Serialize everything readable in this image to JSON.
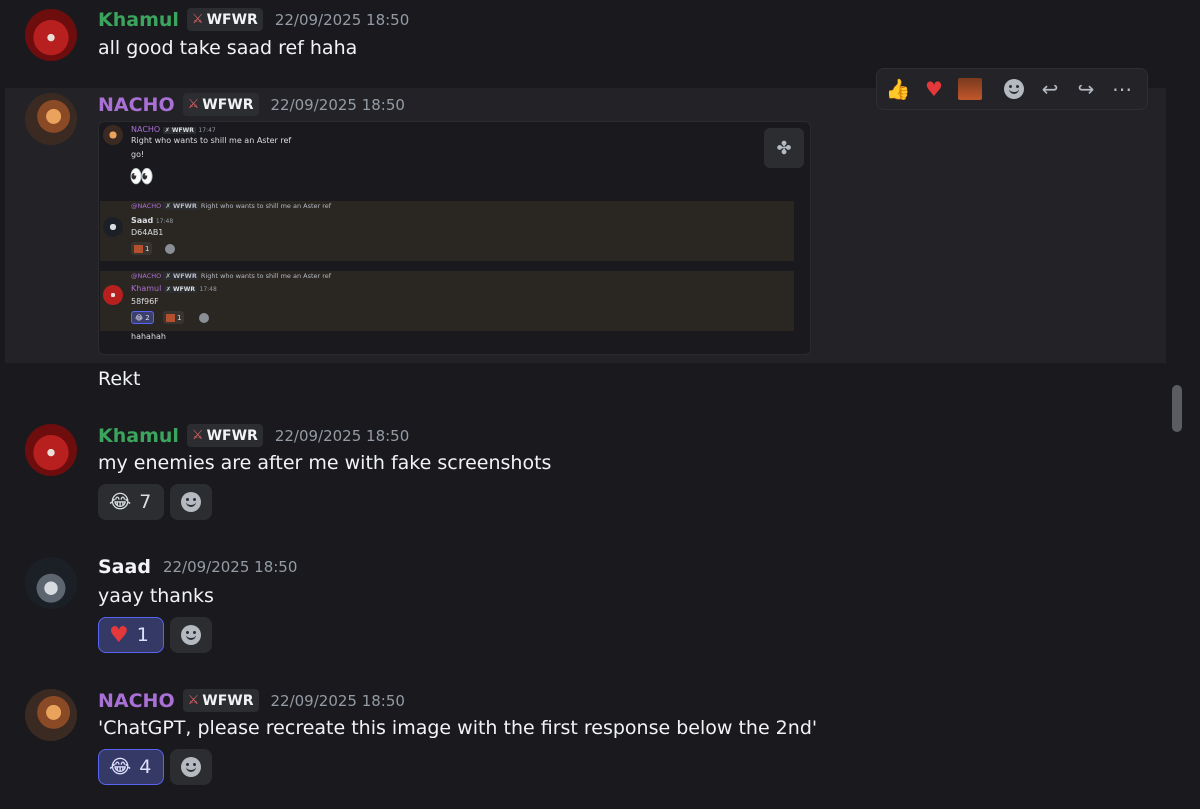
{
  "tag": "WFWR",
  "messages": [
    {
      "user": "Khamul",
      "name_color": "#3ba55d",
      "time": "22/09/2025 18:50",
      "text": "all good take saad ref haha"
    },
    {
      "user": "NACHO",
      "name_color": "#a970d6",
      "time": "22/09/2025 18:50",
      "text": "Rekt"
    },
    {
      "user": "Khamul",
      "name_color": "#3ba55d",
      "time": "22/09/2025 18:50",
      "text": "my enemies are after me with fake screenshots",
      "reactions": [
        {
          "emoji": "😂",
          "count": "7",
          "active": false
        }
      ]
    },
    {
      "user": "Saad",
      "name_color": "#f2f3f5",
      "time": "22/09/2025 18:50",
      "text": "yaay thanks",
      "reactions": [
        {
          "emoji": "❤️",
          "count": "1",
          "active": true
        }
      ]
    },
    {
      "user": "NACHO",
      "name_color": "#a970d6",
      "time": "22/09/2025 18:50",
      "text": "'ChatGPT, please recreate this image with the first response below the 2nd'",
      "reactions": [
        {
          "emoji": "😂",
          "count": "4",
          "active": true
        }
      ]
    }
  ],
  "hover_bar": {
    "icons": [
      "thumbs-up",
      "heart",
      "custom-emoji",
      "add-reaction",
      "reply",
      "forward",
      "more"
    ],
    "glyphs": [
      "👍",
      "❤️",
      "",
      "",
      "↩",
      "↪",
      "⋯"
    ]
  },
  "embed": {
    "header_user": "NACHO",
    "header_tag": "WFWR",
    "header_time": "17:47",
    "line1": "Right who wants to shill me an Aster ref",
    "line2": "go!",
    "eyes": "👀",
    "reply1": {
      "mention": "@NACHO",
      "tag": "WFWR",
      "ref": "Right who wants to shill me an Aster ref",
      "user": "Saad",
      "time": "17:48",
      "text": "D64AB1",
      "react_count": "1"
    },
    "reply2": {
      "mention": "@NACHO",
      "tag": "WFWR",
      "ref": "Right who wants to shill me an Aster ref",
      "user": "Khamul",
      "tag2": "WFWR",
      "time": "17:48",
      "text": "58f96F",
      "react1": "😂",
      "react1_count": "2",
      "react2_count": "1"
    },
    "footer": "hahahah"
  }
}
